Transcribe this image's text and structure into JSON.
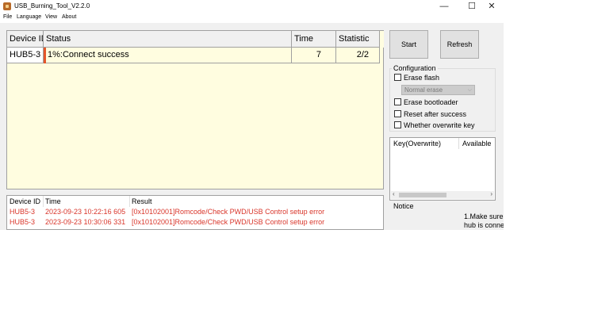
{
  "window": {
    "title": "USB_Burning_Tool_V2.2.0",
    "minimize_glyph": "—",
    "maximize_glyph": "☐",
    "close_glyph": "✕"
  },
  "menu": [
    "File",
    "Language",
    "View",
    "About"
  ],
  "device_table": {
    "headers": [
      "Device ID",
      "Status",
      "Time",
      "Statistic"
    ],
    "rows": [
      {
        "device_id": "HUB5-3",
        "status": "1%:Connect success",
        "time": "7",
        "statistic": "2/2"
      }
    ]
  },
  "buttons": {
    "start": "Start",
    "refresh": "Refresh"
  },
  "configuration": {
    "title": "Configuration",
    "erase_flash": "Erase flash",
    "erase_mode": "Normal erase",
    "erase_bootloader": "Erase bootloader",
    "reset_after_success": "Reset after success",
    "overwrite_key": "Whether overwrite key"
  },
  "key_table": {
    "headers": [
      "Key(Overwrite)",
      "Available"
    ]
  },
  "notice": {
    "title": "Notice",
    "lines": [
      "1.Make sure",
      "hub is conne"
    ]
  },
  "log_table": {
    "headers": [
      "Device ID",
      "Time",
      "Result"
    ],
    "rows": [
      {
        "device_id": "HUB5-3",
        "time": "2023-09-23 10:22:16 605",
        "result": "[0x10102001]Romcode/Check PWD/USB Control setup error"
      },
      {
        "device_id": "HUB5-3",
        "time": "2023-09-23 10:30:06 331",
        "result": "[0x10102001]Romcode/Check PWD/USB Control setup error"
      }
    ]
  },
  "colors": {
    "grid_background": "#fffde0",
    "error_text": "#d9362b",
    "progress_accent": "#e4562a"
  }
}
